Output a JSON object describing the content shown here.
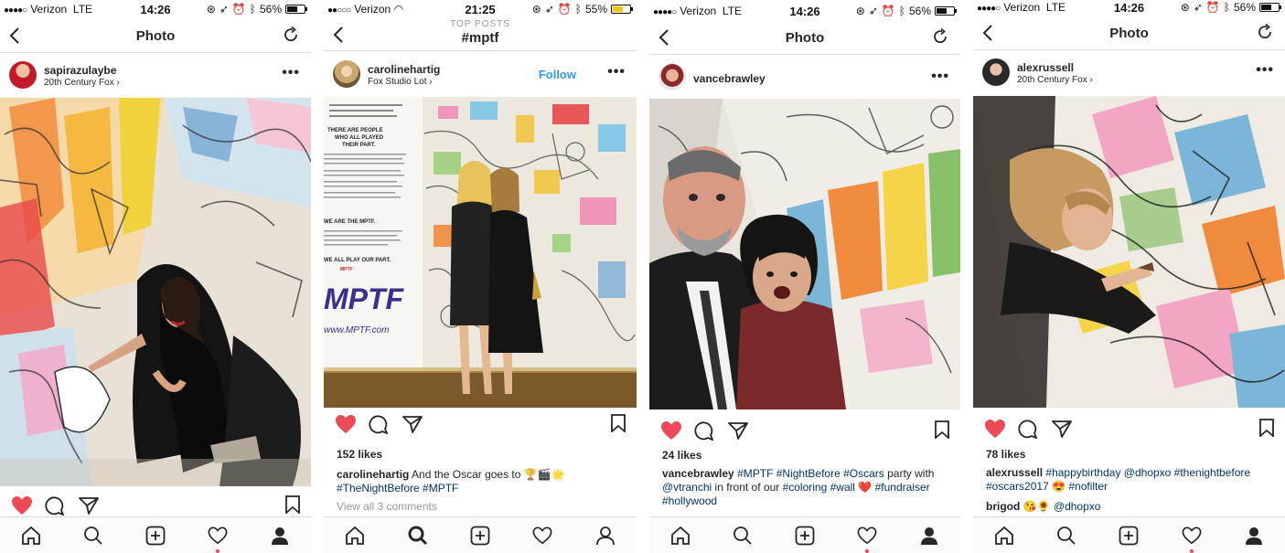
{
  "colors": {
    "heart_red": "#ed4956",
    "link_blue": "#3897f0",
    "hashtag_blue": "#003569"
  },
  "panels": [
    {
      "status": {
        "carrier": "Verizon",
        "network": "LTE",
        "time": "14:26",
        "battery": "56%",
        "signal": "●●●●○"
      },
      "nav": {
        "title": "Photo"
      },
      "post": {
        "username": "sapirazulaybe",
        "location": "20th Century Fox",
        "location_arrow": "›"
      },
      "tabs": [
        "home-icon",
        "search-icon",
        "add-icon",
        "heart-icon",
        "profile-icon"
      ]
    },
    {
      "status": {
        "carrier": "Verizon",
        "time": "21:25",
        "battery": "55%",
        "signal": "●●○○○"
      },
      "nav": {
        "subtitle": "TOP POSTS",
        "title": "#mptf"
      },
      "post": {
        "username": "carolinehartig",
        "location": "Fox Studio Lot",
        "location_arrow": "›",
        "follow": "Follow",
        "likes": "152 likes",
        "caption_user": "carolinehartig",
        "caption_text": "And the Oscar goes to",
        "caption_emoji": "🏆🎬🌟",
        "caption_tags": "#TheNightBefore #MPTF",
        "view_all": "View all 3 comments"
      }
    },
    {
      "status": {
        "carrier": "Verizon",
        "network": "LTE",
        "time": "14:26",
        "battery": "56%",
        "signal": "●●●●○"
      },
      "nav": {
        "title": "Photo"
      },
      "post": {
        "username": "vancebrawley",
        "likes": "24 likes",
        "caption_user": "vancebrawley",
        "caption_line1_tags": "#MPTF #NightBefore #Oscars",
        "caption_line1_text": " party with",
        "caption_line2_mention": "@vtranchi",
        "caption_line2_text": " in front of our ",
        "caption_line2_tags": "#coloring #wall",
        "caption_line2_heart": "❤️",
        "caption_line2_tag2": " #fundraiser",
        "caption_line3_tag": "#hollywood"
      }
    },
    {
      "status": {
        "carrier": "Verizon",
        "network": "LTE",
        "time": "14:26",
        "battery": "56%",
        "signal": "●●●●○"
      },
      "nav": {
        "title": "Photo"
      },
      "post": {
        "username": "alexrussell",
        "location": "20th Century Fox",
        "location_arrow": "›",
        "likes": "78 likes",
        "caption_user": "alexrussell",
        "caption_line1_tags": "#happybirthday @dhopxo #thenightbefore",
        "caption_line2_tags": "#oscars2017",
        "caption_line2_emoji": "😍",
        "caption_line2_tag2": " #nofilter",
        "comment_user": "brigod",
        "comment_emoji": "😘🌻",
        "comment_mention": "@dhopxo"
      }
    }
  ],
  "photo_text": {
    "p1_wall_lines": [
      "THERE ARE PEOPLE",
      "WHO ALL PLAYED",
      "THEIR PART.",
      "WE ARE THE MPTF.",
      "WE ALL PLAY OUR PART."
    ],
    "p1_logo": "MPTF",
    "p1_url": "www.MPTF.com",
    "p1_small_logo": "MPTF"
  }
}
